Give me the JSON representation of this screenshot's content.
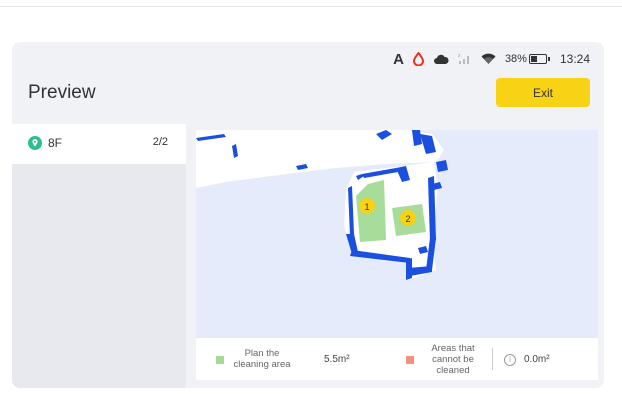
{
  "status_bar": {
    "indicator_letter": "A",
    "battery_percent": "38%",
    "time": "13:24",
    "icons": [
      "a-indicator",
      "water-drop-icon",
      "cloud-icon",
      "cellular-signal-icon",
      "wifi-icon",
      "battery-icon"
    ]
  },
  "header": {
    "title": "Preview",
    "exit_label": "Exit"
  },
  "sidebar": {
    "floor": {
      "label": "8F",
      "count": "2/2",
      "icon": "location-pin-icon"
    }
  },
  "map": {
    "rooms": [
      {
        "label": "1"
      },
      {
        "label": "2"
      }
    ]
  },
  "legend": {
    "planned_label": "Plan the cleaning area",
    "planned_value": "5.5m²",
    "uncleanable_label": "Areas that cannot be cleaned",
    "uncleanable_value": "0.0m²",
    "colors": {
      "planned": "#a5d99a",
      "uncleanable": "#f0927d",
      "accent": "#f7d215"
    }
  }
}
